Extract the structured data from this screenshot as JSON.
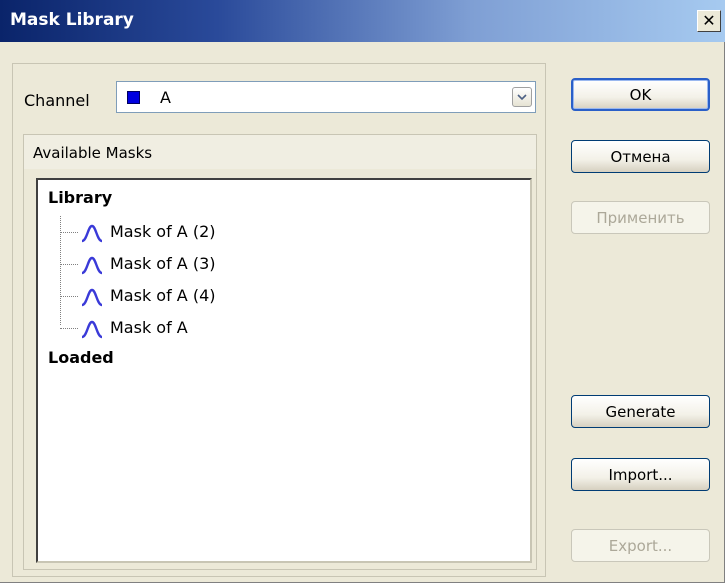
{
  "window": {
    "title": "Mask Library",
    "close_glyph": "✕"
  },
  "channel": {
    "label": "Channel",
    "value": "A",
    "swatch_color": "#0000e0"
  },
  "available_masks": {
    "title": "Available Masks",
    "groups": [
      {
        "label": "Library",
        "items": [
          "Mask of A (2)",
          "Mask of A (3)",
          "Mask of A (4)",
          "Mask of A"
        ]
      },
      {
        "label": "Loaded",
        "items": []
      }
    ]
  },
  "buttons": {
    "ok": "OK",
    "cancel": "Отмена",
    "apply": "Применить",
    "generate": "Generate",
    "import": "Import...",
    "export": "Export..."
  },
  "icons": {
    "mask_item": "waveform-icon",
    "combo_arrow": "chevron-down-icon"
  },
  "colors": {
    "mask_icon": "#3a3ad8",
    "titlebar_start": "#0a246a",
    "titlebar_end": "#a6caf0"
  }
}
